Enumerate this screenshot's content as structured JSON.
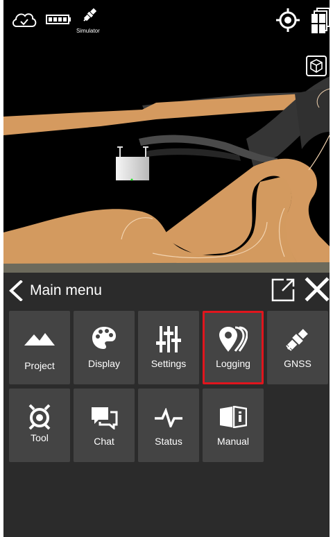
{
  "status_bar": {
    "cloud_icon": "cloud-check-icon",
    "battery_icon": "battery-icon",
    "satellite_icon": "satellite-icon",
    "satellite_label": "Simulator",
    "locate_icon": "locate-target-icon",
    "layers_icon": "layers-icon",
    "view_cube_icon": "3d-cube-icon"
  },
  "menu": {
    "title": "Main menu",
    "back_icon": "chevron-left-icon",
    "popout_icon": "external-window-icon",
    "close_icon": "close-icon",
    "items": [
      {
        "label": "Project",
        "icon": "mountain-icon"
      },
      {
        "label": "Display",
        "icon": "palette-icon"
      },
      {
        "label": "Settings",
        "icon": "sliders-icon"
      },
      {
        "label": "Logging",
        "icon": "location-pins-icon",
        "selected": true
      },
      {
        "label": "GNSS",
        "icon": "satellite-icon"
      },
      {
        "label": "Tool",
        "icon": "tool-icon"
      },
      {
        "label": "Chat",
        "icon": "chat-icon"
      },
      {
        "label": "Status",
        "icon": "pulse-icon"
      },
      {
        "label": "Manual",
        "icon": "manual-book-icon"
      }
    ]
  },
  "colors": {
    "panel_bg": "#2b2b2b",
    "tile_bg": "#444444",
    "selected_outline": "#e0151d",
    "terrain_orange": "#d79a5e",
    "terrain_dark": "#2e2e2e"
  }
}
